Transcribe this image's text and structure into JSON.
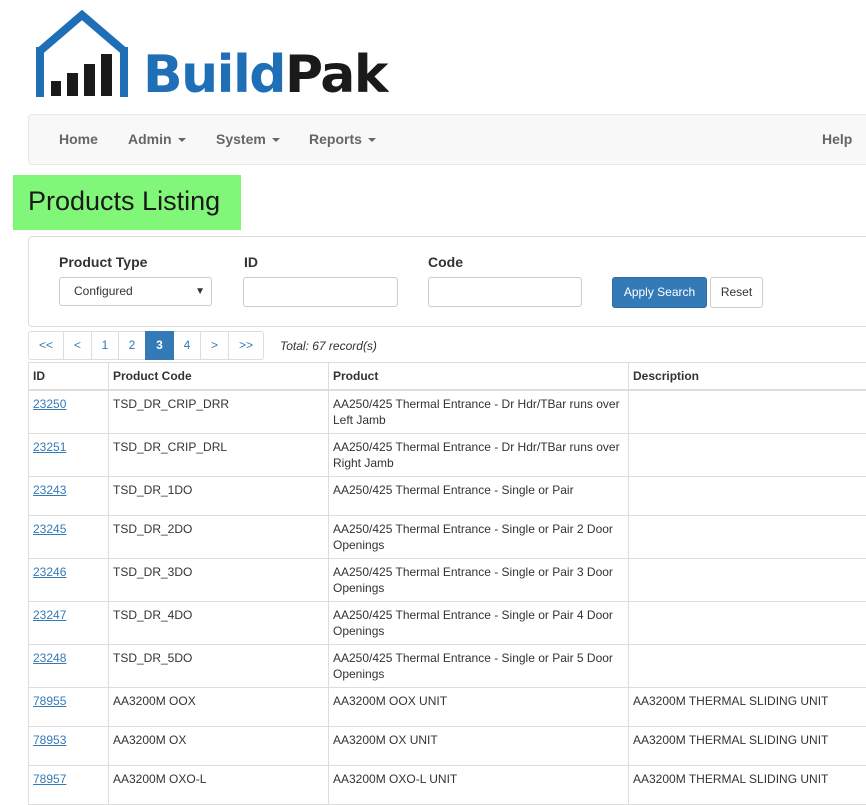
{
  "brand": {
    "part1": "Build",
    "part2": "Pak"
  },
  "nav": {
    "home": "Home",
    "admin": "Admin",
    "system": "System",
    "reports": "Reports",
    "help": "Help"
  },
  "page_title": "Products Listing",
  "filters": {
    "product_type_label": "Product Type",
    "product_type_value": "Configured",
    "id_label": "ID",
    "id_value": "",
    "code_label": "Code",
    "code_value": "",
    "apply_label": "Apply Search",
    "reset_label": "Reset"
  },
  "pagination": {
    "first": "<<",
    "prev": "<",
    "pages": [
      "1",
      "2",
      "3",
      "4"
    ],
    "current_page": "3",
    "next": ">",
    "last": ">>",
    "total": "Total: 67 record(s)"
  },
  "table": {
    "columns": [
      "ID",
      "Product Code",
      "Product",
      "Description"
    ],
    "rows": [
      [
        "23250",
        "TSD_DR_CRIP_DRR",
        "AA250/425 Thermal Entrance - Dr Hdr/TBar runs over Left Jamb",
        ""
      ],
      [
        "23251",
        "TSD_DR_CRIP_DRL",
        "AA250/425 Thermal Entrance - Dr Hdr/TBar runs over Right Jamb",
        ""
      ],
      [
        "23243",
        "TSD_DR_1DO",
        "AA250/425 Thermal Entrance - Single or Pair",
        ""
      ],
      [
        "23245",
        "TSD_DR_2DO",
        "AA250/425 Thermal Entrance - Single or Pair 2 Door Openings",
        ""
      ],
      [
        "23246",
        "TSD_DR_3DO",
        "AA250/425 Thermal Entrance - Single or Pair 3 Door Openings",
        ""
      ],
      [
        "23247",
        "TSD_DR_4DO",
        "AA250/425 Thermal Entrance - Single or Pair 4 Door Openings",
        ""
      ],
      [
        "23248",
        "TSD_DR_5DO",
        "AA250/425 Thermal Entrance - Single or Pair 5 Door Openings",
        ""
      ],
      [
        "78955",
        "AA3200M OOX",
        "AA3200M OOX UNIT",
        "AA3200M THERMAL SLIDING UNIT"
      ],
      [
        "78953",
        "AA3200M OX",
        "AA3200M OX UNIT",
        "AA3200M THERMAL SLIDING UNIT"
      ],
      [
        "78957",
        "AA3200M OXO-L",
        "AA3200M OXO-L UNIT",
        "AA3200M THERMAL SLIDING UNIT"
      ]
    ]
  },
  "colors": {
    "brand_blue": "#1f6fb7",
    "title_highlight": "#80f779",
    "primary": "#337ab7"
  },
  "icons": {
    "logo": "house-bars-icon",
    "select_arrow": "triangle-down-icon"
  }
}
